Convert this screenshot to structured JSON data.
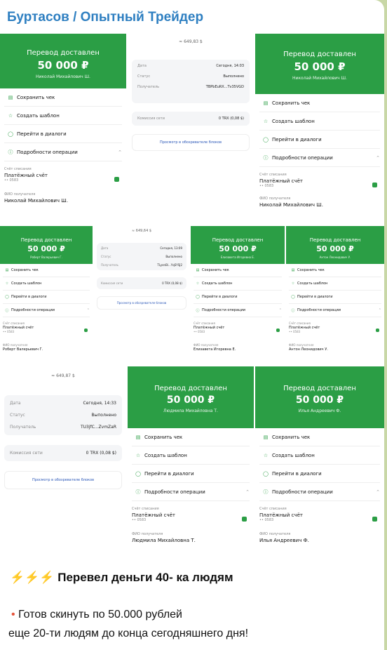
{
  "channel_title": "Буртасов / Опытный Трейдер",
  "labels": {
    "delivered": "Перевод доставлен",
    "amount": "50 000 ₽",
    "save": "Сохранить чек",
    "template": "Создать шаблон",
    "dialog": "Перейти в диалоги",
    "details": "Подробности операции",
    "debit_account": "Счёт списания",
    "payment_account": "Платёжный счёт",
    "mask": "•• 0583",
    "recipient": "ФИО получателя",
    "date": "Дата",
    "status": "Статус",
    "status_value": "Выполнено",
    "receiver": "Получатель",
    "fee": "Комиссия сети",
    "fee_value": "0 TRX (0,08 $)",
    "explorer": "Просмотр в обозревателе блоков"
  },
  "shots": [
    {
      "name": "Николай Михайлович Ш."
    },
    {
      "name": "Николай Михайлович Ш."
    },
    {
      "name": "Роберт Валерьевич Г."
    },
    {
      "name": "Елизавета Игоревна Е."
    },
    {
      "name": "Антон Леонидович У."
    },
    {
      "name": "Людмила Михайловна Т."
    },
    {
      "name": "Илья Андреевич Ф."
    }
  ],
  "crypto": [
    {
      "usd": "≈ 649,83 $",
      "date": "Сегодня, 14:03",
      "addr": "TBPbEuRX...Tv35VGD"
    },
    {
      "usd": "≈ 649,64 $",
      "date": "Сегодня, 13:09",
      "addr": "TLyenBi...YqSYSJ2"
    },
    {
      "usd": "≈ 649,87 $",
      "date": "Сегодня, 14:33",
      "addr": "TU3jfC...ZvmZaR"
    }
  ],
  "message": {
    "bolts": "⚡⚡⚡",
    "line1": "Перевел деньги 40- ка людям",
    "bullet": "•",
    "line2": "Готов скинуть по 50.000 рублей",
    "line3": "еще 20-ти людям до конца сегодняшнего дня!"
  },
  "colors": {
    "green": "#2b9e45",
    "title_blue": "#2e7fc1",
    "link_blue": "#2c58b8"
  },
  "icons": [
    "receipt-icon",
    "star-icon",
    "chat-icon",
    "info-icon",
    "chevron-up-icon",
    "lightning-icon"
  ]
}
